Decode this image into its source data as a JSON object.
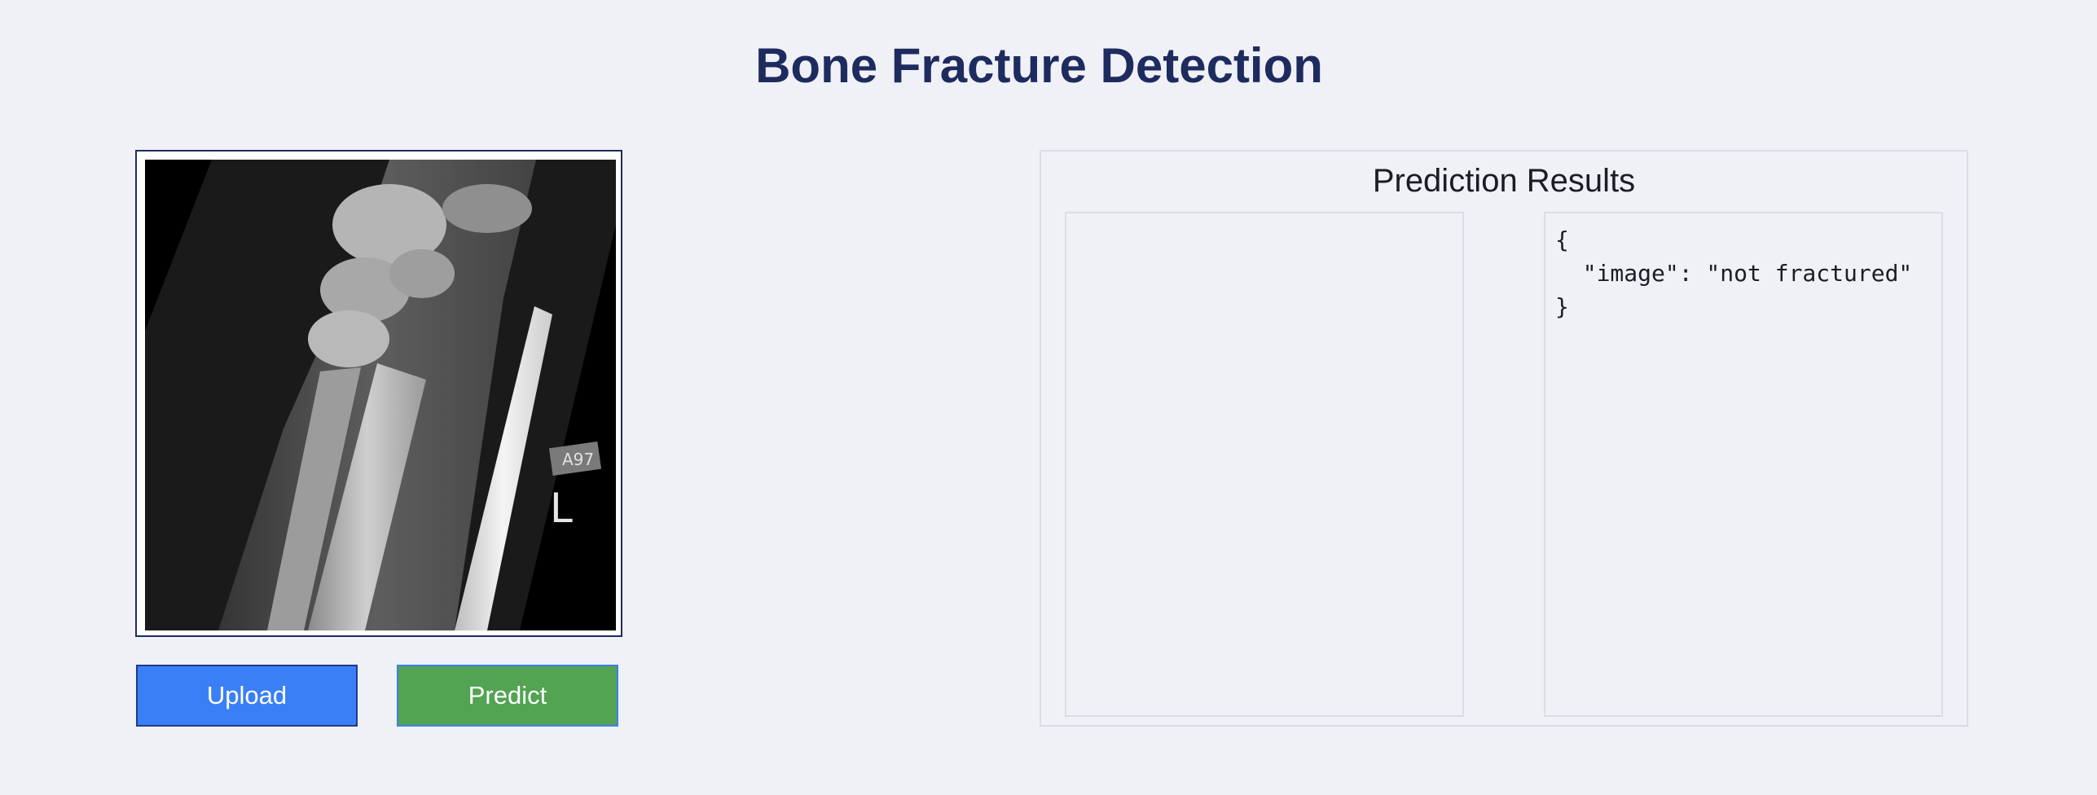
{
  "header": {
    "title": "Bone Fracture Detection"
  },
  "upload_panel": {
    "image_alt": "wrist x-ray",
    "image_marker_text": "A97",
    "image_side_letter": "L",
    "upload_label": "Upload",
    "predict_label": "Predict"
  },
  "results": {
    "title": "Prediction Results",
    "json_output": "{\n  \"image\": \"not fractured\"\n}"
  },
  "colors": {
    "title": "#1e2b5e",
    "upload_button": "#3b7ff6",
    "predict_button": "#52a352",
    "background": "#f0f1f6"
  }
}
